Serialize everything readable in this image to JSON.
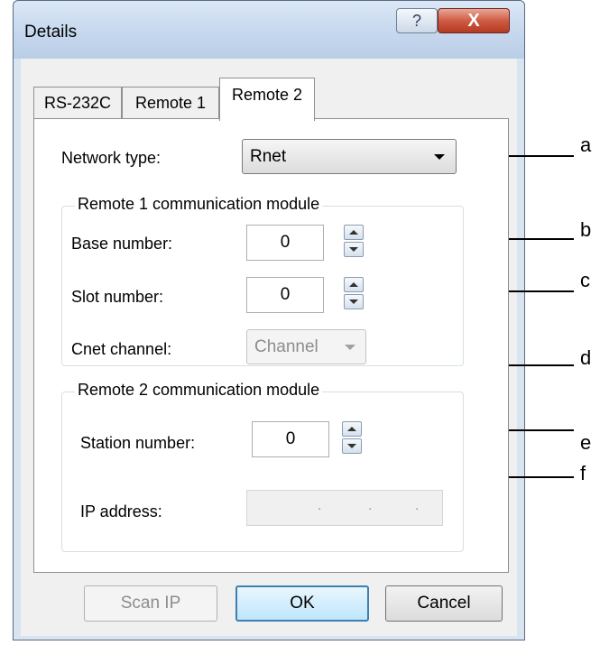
{
  "window": {
    "title": "Details",
    "help_label": "?",
    "close_label": "X"
  },
  "tabs": [
    {
      "label": "RS-232C",
      "active": false
    },
    {
      "label": "Remote 1",
      "active": false
    },
    {
      "label": "Remote 2",
      "active": true
    }
  ],
  "network": {
    "label": "Network type:",
    "value": "Rnet"
  },
  "remote1": {
    "legend": "Remote 1 communication module",
    "base_label": "Base number:",
    "base_value": "0",
    "slot_label": "Slot number:",
    "slot_value": "0",
    "cnet_label": "Cnet channel:",
    "cnet_value": "Channel"
  },
  "remote2": {
    "legend": "Remote 2 communication module",
    "station_label": "Station number:",
    "station_value": "0",
    "ip_label": "IP address:",
    "ip_dots": [
      ".",
      ".",
      "."
    ]
  },
  "buttons": {
    "scan_ip": "Scan IP",
    "ok": "OK",
    "cancel": "Cancel"
  },
  "annotations": {
    "a": "a",
    "b": "b",
    "c": "c",
    "d": "d",
    "e": "e",
    "f": "f"
  },
  "colors": {
    "titlebar": "#c6d8ee",
    "close_button": "#cf5b43",
    "ok_border": "#3c7fb1"
  }
}
